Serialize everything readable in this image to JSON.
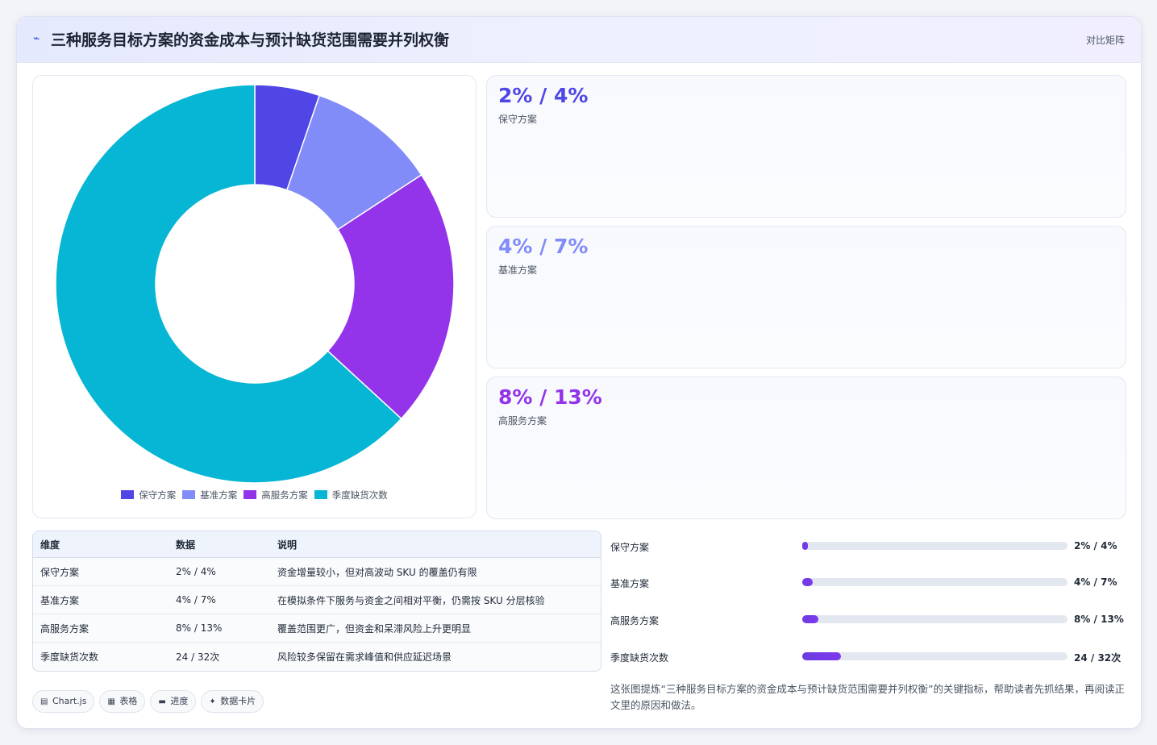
{
  "header": {
    "icon": "bolt-icon",
    "title": "三种服务目标方案的资金成本与预计缺货范围需要并列权衡",
    "badge": "对比矩阵"
  },
  "chart_data": {
    "type": "pie",
    "categories": [
      "保守方案",
      "基准方案",
      "高服务方案",
      "季度缺货次数"
    ],
    "values": [
      2,
      4,
      8,
      24
    ],
    "colors": [
      "#4f46e5",
      "#818cf8",
      "#9333ea",
      "#06b6d4"
    ],
    "donut": true,
    "legend_position": "bottom"
  },
  "stats": [
    {
      "value": "2% / 4%",
      "label": "保守方案",
      "color": "#4f46e5"
    },
    {
      "value": "4% / 7%",
      "label": "基准方案",
      "color": "#818cf8"
    },
    {
      "value": "8% / 13%",
      "label": "高服务方案",
      "color": "#9333ea"
    }
  ],
  "table": {
    "headers": [
      "维度",
      "数据",
      "说明"
    ],
    "rows": [
      [
        "保守方案",
        "2% / 4%",
        "资金增量较小，但对高波动 SKU 的覆盖仍有限"
      ],
      [
        "基准方案",
        "4% / 7%",
        "在模拟条件下服务与资金之间相对平衡，仍需按 SKU 分层核验"
      ],
      [
        "高服务方案",
        "8% / 13%",
        "覆盖范围更广，但资金和呆滞风险上升更明显"
      ],
      [
        "季度缺货次数",
        "24 / 32次",
        "风险较多保留在需求峰值和供应延迟场景"
      ]
    ]
  },
  "progress": [
    {
      "label": "保守方案",
      "value": "2% / 4%",
      "fraction": 0.02
    },
    {
      "label": "基准方案",
      "value": "4% / 7%",
      "fraction": 0.04
    },
    {
      "label": "高服务方案",
      "value": "8% / 13%",
      "fraction": 0.06
    },
    {
      "label": "季度缺货次数",
      "value": "24 / 32次",
      "fraction": 0.145
    }
  ],
  "tags": [
    {
      "icon": "chart-icon",
      "glyph": "▤",
      "label": "Chart.js"
    },
    {
      "icon": "table-icon",
      "glyph": "▦",
      "label": "表格"
    },
    {
      "icon": "progress-icon",
      "glyph": "▬",
      "label": "进度"
    },
    {
      "icon": "sparkle-icon",
      "glyph": "✦",
      "label": "数据卡片"
    }
  ],
  "summary": "这张图提炼“三种服务目标方案的资金成本与预计缺货范围需要并列权衡”的关键指标，帮助读者先抓结果，再阅读正文里的原因和做法。"
}
